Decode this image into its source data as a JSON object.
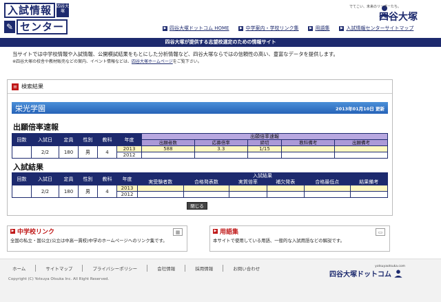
{
  "header": {
    "logo_line1": "入試情報",
    "logo_badge": "四谷大塚",
    "logo_line2": "センター",
    "brand_tag": "でてこい、未来のリーダーたち。",
    "brand_name": "四谷大塚",
    "nav": [
      {
        "label": "四谷大塚ドットコム HOME"
      },
      {
        "label": "中学案内・学校リンク集"
      },
      {
        "label": "用語集"
      },
      {
        "label": "入試情報センターサイトマップ"
      }
    ]
  },
  "band_text": "四谷大塚が提供する志望校選定のための情報サイト",
  "intro": {
    "line1": "当サイトでは中学校情報や入試情報、公開模試結果をもとにした分析情報など、四谷大塚ならではの信頼性の高い、豊富なデータを提供します。",
    "note_prefix": "※四谷大塚の校舎や教材販売などの案内、イベント情報などは、",
    "note_link": "四谷大塚ホームページ",
    "note_suffix": "をご覧下さい。"
  },
  "panel": {
    "title": "検索結果",
    "school_name": "栄光学園",
    "updated": "2013年01月10日 更新",
    "section1": {
      "title": "出願倍率速報",
      "headers": {
        "kaisu": "回数",
        "date": "入試日",
        "capacity": "定員",
        "gender": "性別",
        "subjects": "教科",
        "year": "年度",
        "group": "出願倍率速報",
        "sub": [
          "出願者数",
          "応募倍率",
          "締切",
          "教科備考",
          "出願備考"
        ]
      },
      "row": {
        "kaisu": "",
        "date": "2/2",
        "capacity": "180",
        "gender": "男",
        "subjects": "4",
        "year1": "2013",
        "year2": "2012",
        "values1": [
          "588",
          "3.3",
          "1/15",
          "",
          ""
        ],
        "values2": [
          "",
          "",
          "",
          "",
          ""
        ]
      }
    },
    "section2": {
      "title": "入試結果",
      "headers": {
        "kaisu": "回数",
        "date": "入試日",
        "capacity": "定員",
        "gender": "性別",
        "subjects": "教科",
        "year": "年度",
        "group": "入試結果",
        "sub": [
          "実受験者数",
          "合格発表数",
          "実質倍率",
          "補欠発表",
          "合格最低点",
          "結果備考"
        ]
      },
      "row": {
        "kaisu": "",
        "date": "2/2",
        "capacity": "180",
        "gender": "男",
        "subjects": "4",
        "year1": "2013",
        "year2": "2012"
      }
    },
    "close_label": "閉じる"
  },
  "cards": [
    {
      "title": "中学校リンク",
      "body": "全国の私立・国公立(公立は中高一貫校)中学のホームページへのリンク集です。"
    },
    {
      "title": "用語集",
      "body": "本サイトで使用している用語、一般的な入試用語などの解説です。"
    }
  ],
  "footer": {
    "nav": [
      "ホーム",
      "サイトマップ",
      "プライバシーポリシー",
      "会社情報",
      "採用情報",
      "お問い合わせ"
    ],
    "copyright": "Copyright (C) Yotsuya Otsuka Inc. All Right Reserved.",
    "brand_tag": "yotsuyaotsuka.com",
    "brand_name": "四谷大塚ドットコム"
  },
  "colors": {
    "navy": "#1d2a6e",
    "blue_bar": "#2763b8",
    "red": "#c01818",
    "lavender": "#b8a8e0"
  }
}
